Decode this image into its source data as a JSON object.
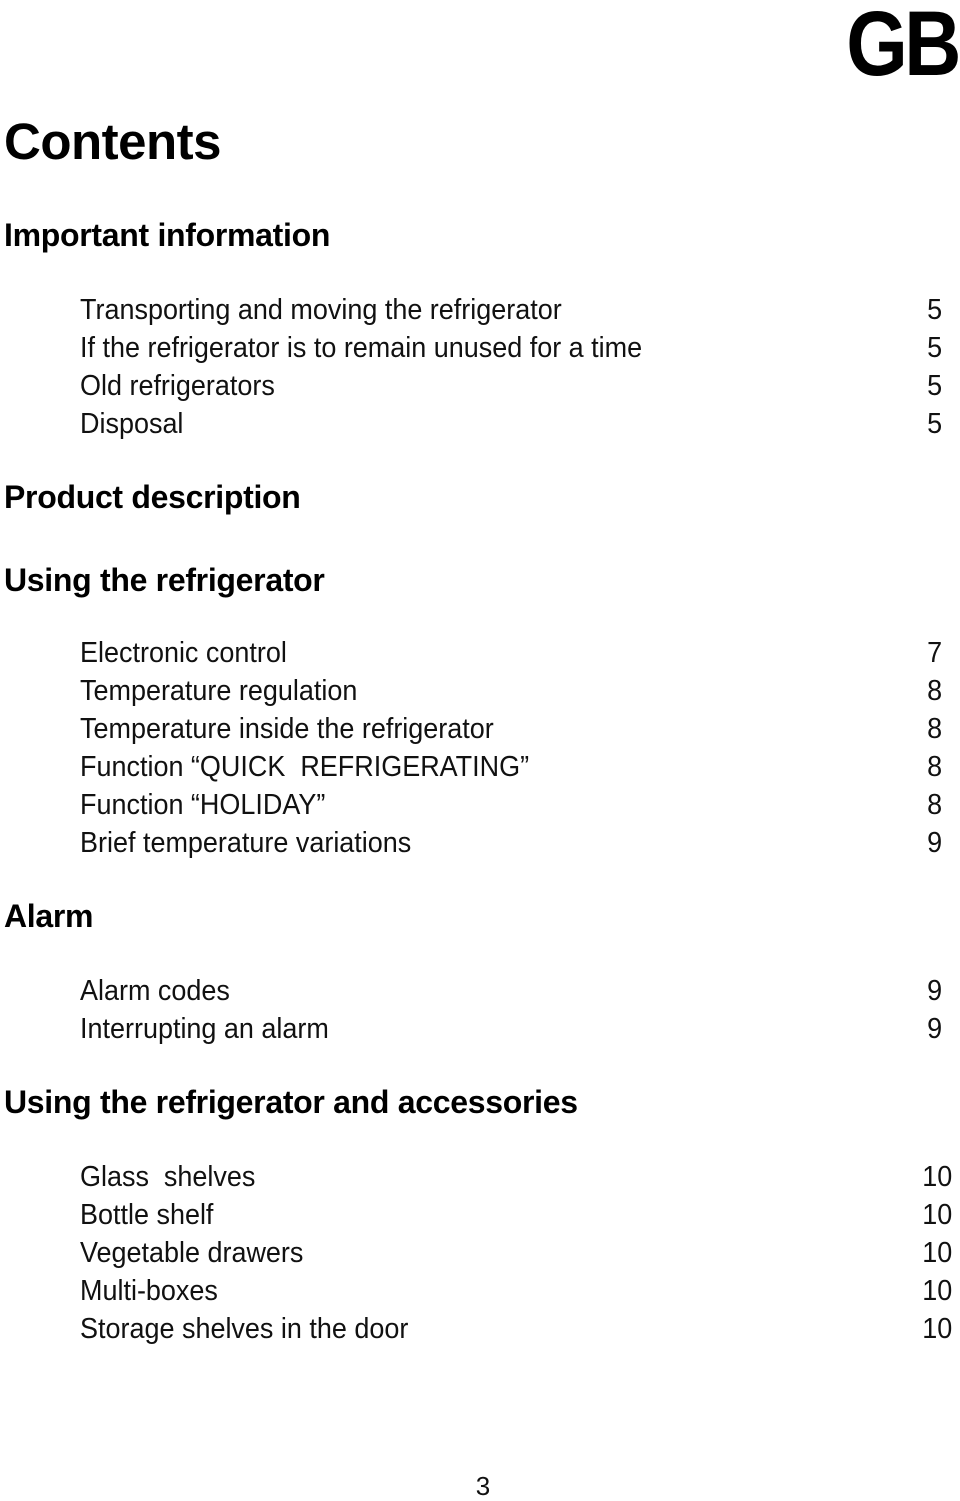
{
  "header": {
    "country_code": "GB",
    "title": "Contents"
  },
  "sections": [
    {
      "heading": "Important information",
      "entries": [
        {
          "label": "Transporting and moving the refrigerator",
          "page": "5"
        },
        {
          "label": "If the refrigerator is to remain unused for a time",
          "page": "5"
        },
        {
          "label": "Old refrigerators",
          "page": "5"
        },
        {
          "label": "Disposal",
          "page": "5"
        }
      ]
    },
    {
      "heading": "Product description",
      "entries": []
    },
    {
      "heading": "Using the refrigerator",
      "entries": [
        {
          "label": "Electronic control",
          "page": "7"
        },
        {
          "label": "Temperature regulation",
          "page": "8"
        },
        {
          "label": "Temperature inside the refrigerator",
          "page": "8"
        },
        {
          "label": "Function “QUICK  REFRIGERATING”",
          "page": "8"
        },
        {
          "label": "Function “HOLIDAY”",
          "page": "8"
        },
        {
          "label": "Brief temperature variations",
          "page": "9"
        }
      ]
    },
    {
      "heading": "Alarm",
      "entries": [
        {
          "label": "Alarm codes",
          "page": "9"
        },
        {
          "label": "Interrupting an alarm",
          "page": "9"
        }
      ]
    },
    {
      "heading": "Using the refrigerator and accessories",
      "entries": [
        {
          "label": "Glass  shelves",
          "page": "10"
        },
        {
          "label": "Bottle shelf",
          "page": "10"
        },
        {
          "label": "Vegetable drawers",
          "page": "10"
        },
        {
          "label": "Multi-boxes",
          "page": "10"
        },
        {
          "label": "Storage shelves in the door",
          "page": "10"
        }
      ]
    }
  ],
  "footer": {
    "page_number": "3"
  }
}
